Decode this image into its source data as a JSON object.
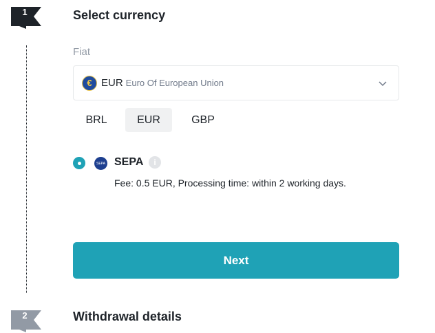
{
  "steps": [
    {
      "number": "1",
      "title": "Select currency"
    },
    {
      "number": "2",
      "title": "Withdrawal details"
    }
  ],
  "fiat": {
    "label": "Fiat",
    "selected_code": "EUR",
    "selected_name": "Euro Of European Union",
    "selected_icon": "euro-coin-icon",
    "icon_symbol": "€"
  },
  "currency_chips": [
    {
      "label": "BRL",
      "active": false
    },
    {
      "label": "EUR",
      "active": true
    },
    {
      "label": "GBP",
      "active": false
    }
  ],
  "payment_method": {
    "name": "SEPA",
    "logo_text": "SEPA",
    "info_symbol": "i",
    "fee_text": "Fee: 0.5 EUR, Processing time: within 2 working days.",
    "selected": true
  },
  "next_button": {
    "label": "Next"
  },
  "colors": {
    "accent": "#1fa2b6",
    "step_active": "#1e2329",
    "step_inactive": "#929aa5"
  }
}
